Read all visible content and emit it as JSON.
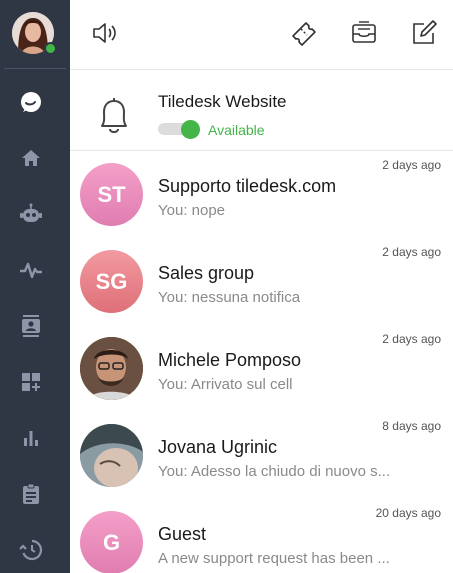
{
  "sidebar": {
    "items": [
      {
        "icon": "chat-bubble-icon",
        "active": true
      },
      {
        "icon": "home-icon"
      },
      {
        "icon": "bot-icon"
      },
      {
        "icon": "activity-icon"
      },
      {
        "icon": "contacts-icon"
      },
      {
        "icon": "apps-icon"
      },
      {
        "icon": "analytics-icon"
      },
      {
        "icon": "clipboard-icon"
      },
      {
        "icon": "history-icon"
      }
    ],
    "status_color": "#43b549"
  },
  "topbar": {
    "icons": [
      "sound-on-icon",
      "ticket-icon",
      "inbox-tray-icon",
      "compose-icon"
    ]
  },
  "status": {
    "title": "Tiledesk Website",
    "availability": "Available",
    "available_color": "#43b549"
  },
  "conversations": [
    {
      "initials": "ST",
      "name": "Supporto tiledesk.com",
      "message": "You: nope",
      "time": "2 days ago",
      "avatar_color": "#ea8fbd"
    },
    {
      "initials": "SG",
      "name": "Sales group",
      "message": "You: nessuna notifica",
      "time": "2 days ago",
      "avatar_color": "#e97f88"
    },
    {
      "initials": "",
      "name": "Michele Pomposo",
      "message": "You: Arrivato sul cell",
      "time": "2 days ago",
      "avatar_color": "#5a4033"
    },
    {
      "initials": "",
      "name": "Jovana Ugrinic",
      "message": "You: Adesso la chiudo di nuovo s...",
      "time": "8 days ago",
      "avatar_color": "#6b7a80"
    },
    {
      "initials": "G",
      "name": "Guest",
      "message": "A new support request has been ...",
      "time": "20 days ago",
      "avatar_color": "#ea8fbd"
    }
  ]
}
